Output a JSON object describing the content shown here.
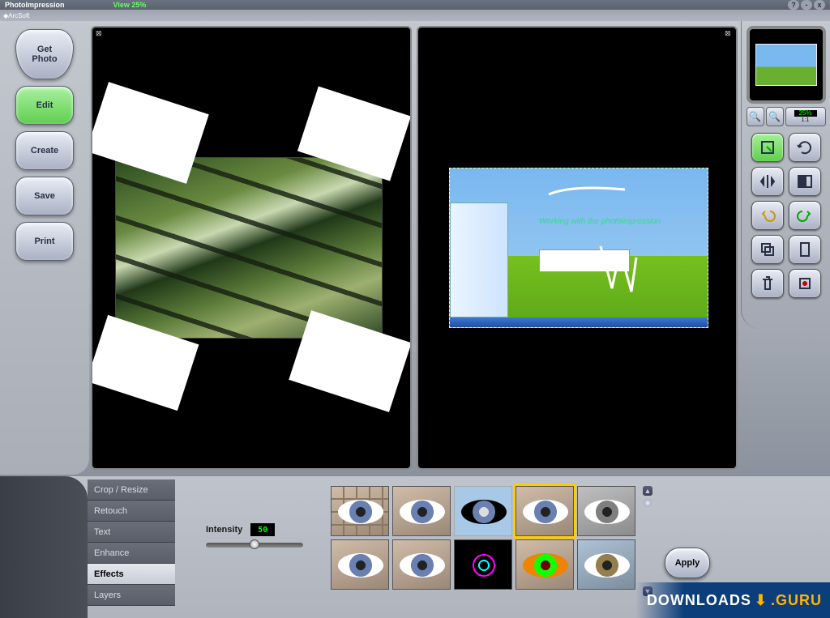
{
  "title": "PhotoImpression",
  "brand": "ArcSoft",
  "view_zoom_label": "View 25%",
  "sidebar": {
    "get_photo": "Get\nPhoto",
    "edit": "Edit",
    "create": "Create",
    "save": "Save",
    "print": "Print"
  },
  "workspace": {
    "right_caption": "Working with the photoimpression"
  },
  "right_panel": {
    "zoom_pct": "25%",
    "zoom_11": "1:1",
    "tools": [
      {
        "name": "crop",
        "active": true
      },
      {
        "name": "rotate",
        "active": false
      },
      {
        "name": "flip-h",
        "active": false
      },
      {
        "name": "flip-v",
        "active": false
      },
      {
        "name": "undo",
        "active": false
      },
      {
        "name": "redo",
        "active": false
      },
      {
        "name": "copy",
        "active": false
      },
      {
        "name": "paste",
        "active": false
      },
      {
        "name": "delete",
        "active": false
      },
      {
        "name": "clear",
        "active": false
      }
    ]
  },
  "bottom": {
    "tabs": [
      "Crop / Resize",
      "Retouch",
      "Text",
      "Enhance",
      "Effects",
      "Layers"
    ],
    "active_tab": "Effects",
    "intensity_label": "Intensity",
    "intensity_value": "50",
    "apply": "Apply",
    "effects": [
      {
        "name": "mosaic"
      },
      {
        "name": "normal"
      },
      {
        "name": "negative"
      },
      {
        "name": "soft",
        "selected": true
      },
      {
        "name": "grayscale"
      },
      {
        "name": "sepia"
      },
      {
        "name": "sharpen"
      },
      {
        "name": "edge"
      },
      {
        "name": "glow"
      },
      {
        "name": "cool"
      }
    ]
  },
  "watermark": {
    "a": "DOWNLOADS",
    "b": ".GURU"
  }
}
